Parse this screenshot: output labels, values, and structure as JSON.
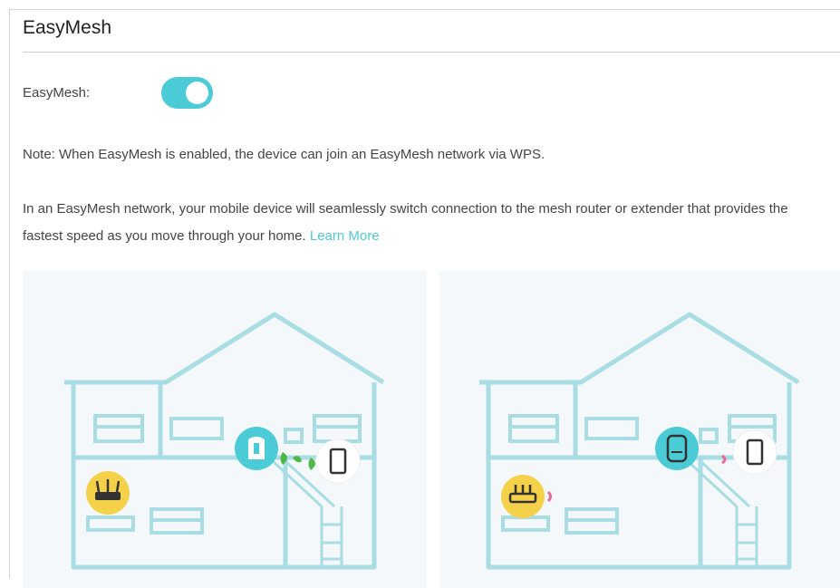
{
  "section": {
    "title": "EasyMesh"
  },
  "easymesh_field": {
    "label": "EasyMesh:",
    "enabled": true
  },
  "note": "Note: When EasyMesh is enabled, the device can join an EasyMesh network via WPS.",
  "description": {
    "text": "In an EasyMesh network, your mobile device will seamlessly switch connection to the mesh router or extender that provides the fastest speed as you move through your home.",
    "link_label": "Learn More"
  },
  "colors": {
    "accent": "#4acbd6",
    "house_outline": "#a8dde4",
    "router_badge": "#f5d14a",
    "signal_green": "#4fb848",
    "signal_pink": "#e86a9a"
  },
  "illustrations": [
    {
      "name": "house-illustration-extender",
      "device_icon": "extender-icon",
      "router_icon": "router-icon",
      "phone_icon": "phone-icon"
    },
    {
      "name": "house-illustration-mesh",
      "device_icon": "mesh-unit-icon",
      "router_icon": "router-icon",
      "phone_icon": "phone-icon"
    }
  ]
}
